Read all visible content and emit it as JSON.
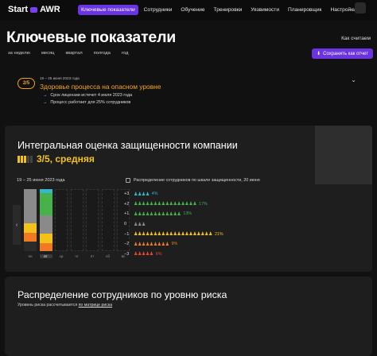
{
  "app": {
    "logo": "Start",
    "logo_suffix": "AWR"
  },
  "nav": {
    "items": [
      {
        "label": "Ключевые показатели",
        "active": true
      },
      {
        "label": "Сотрудники",
        "active": false
      },
      {
        "label": "Обучение",
        "active": false
      },
      {
        "label": "Тренировки",
        "active": false
      },
      {
        "label": "Уязвимости",
        "active": false
      },
      {
        "label": "Планировщик",
        "active": false
      },
      {
        "label": "Настройки",
        "active": false
      }
    ]
  },
  "page": {
    "title": "Ключевые показатели",
    "compare_link": "Как считаем",
    "periods": [
      "за неделю",
      "месяц",
      "квартал",
      "полгода",
      "год"
    ],
    "save_button": "Сохранить как отчет"
  },
  "alert": {
    "badge": "2/5",
    "date": "19 – 25 июня 2023 года",
    "title": "Здоровье процесса на опасном уровне",
    "items": [
      "Срок лицензии истечет 4 июля 2023 года",
      "Процесс работает для 25% сотрудников"
    ]
  },
  "integral": {
    "title": "Интегральная оценка защищенности компании",
    "score_text": "3/5, средняя",
    "score_level": 3,
    "score_max": 5,
    "week_label": "19 – 25 июня 2023 года",
    "days": [
      {
        "label": "пн",
        "active": false,
        "segments": [
          {
            "color": "#8a8a8a",
            "share": 0.55
          },
          {
            "color": "#f2c21b",
            "share": 0.15
          },
          {
            "color": "#f07a24",
            "share": 0.15
          },
          {
            "color": "#2a2a2a",
            "share": 0.15
          }
        ]
      },
      {
        "label": "вт",
        "active": true,
        "segments": [
          {
            "color": "#35b8c9",
            "share": 0.07
          },
          {
            "color": "#47b14a",
            "share": 0.35
          },
          {
            "color": "#8a8a8a",
            "share": 0.3
          },
          {
            "color": "#f2c21b",
            "share": 0.15
          },
          {
            "color": "#f07a24",
            "share": 0.13
          }
        ]
      },
      {
        "label": "ср",
        "active": false,
        "segments": []
      },
      {
        "label": "чт",
        "active": false,
        "segments": []
      },
      {
        "label": "пт",
        "active": false,
        "segments": []
      },
      {
        "label": "сб",
        "active": false,
        "segments": []
      },
      {
        "label": "вс",
        "active": false,
        "segments": []
      }
    ],
    "distribution_title": "Распределение сотрудников по шкале защищенности, 20 июня",
    "distribution": [
      {
        "level": "+3",
        "count": 4,
        "pct": "4%",
        "color": "#35b8c9"
      },
      {
        "level": "+2",
        "count": 16,
        "pct": "17%",
        "color": "#47b14a"
      },
      {
        "level": "+1",
        "count": 12,
        "pct": "13%",
        "color": "#47b14a"
      },
      {
        "level": "0",
        "count": 3,
        "pct": "",
        "color": "#8a8a8a"
      },
      {
        "level": "−1",
        "count": 20,
        "pct": "21%",
        "color": "#f2c21b"
      },
      {
        "level": "−2",
        "count": 9,
        "pct": "9%",
        "color": "#f07a24"
      },
      {
        "level": "−3",
        "count": 5,
        "pct": "6%",
        "color": "#e8462f"
      }
    ]
  },
  "risk": {
    "title": "Распределение сотрудников по уровню риска",
    "subtitle_prefix": "Уровень риска рассчитывается",
    "subtitle_link": "по матрице риска"
  }
}
